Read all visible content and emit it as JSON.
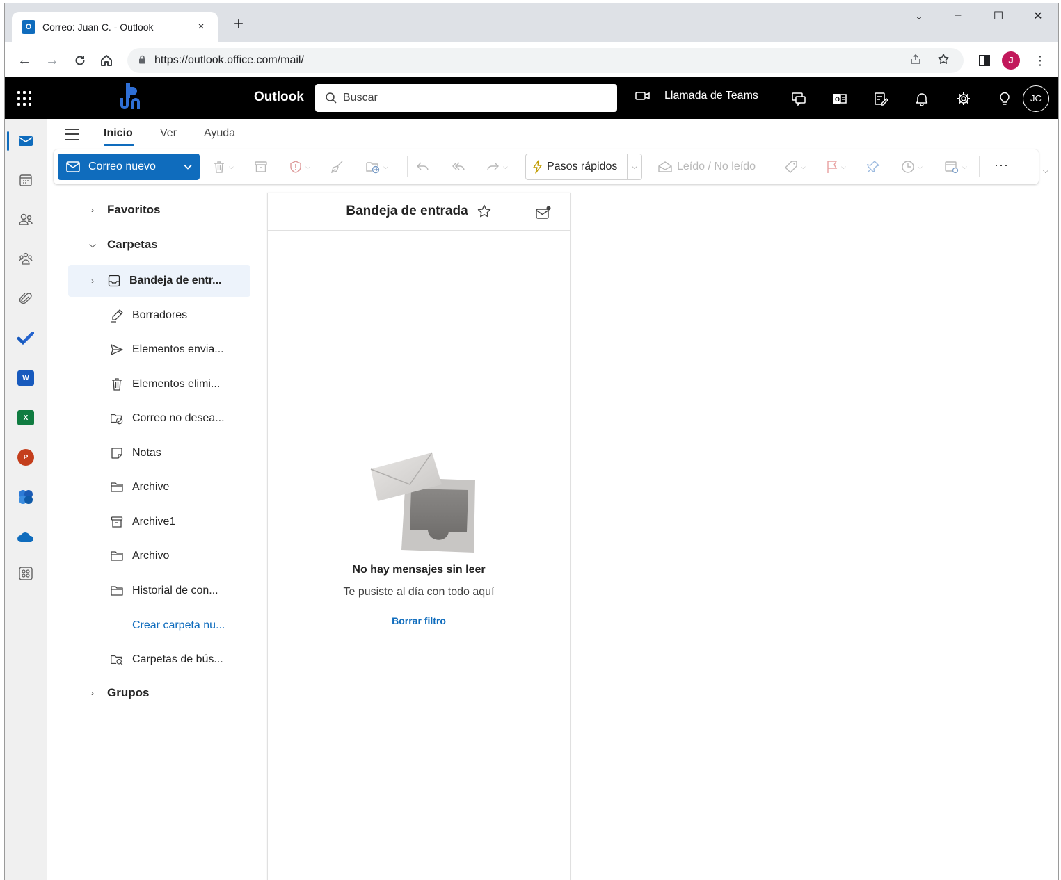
{
  "browser": {
    "tab_title": "Correo: Juan C. - Outlook",
    "tab_close": "×",
    "new_tab": "+",
    "url": "https://outlook.office.com/mail/",
    "profile_initial": "J",
    "controls": {
      "minimize": "–",
      "maximize": "☐",
      "close": "✕",
      "tab_search": "⌄"
    }
  },
  "suite": {
    "app_name": "Outlook",
    "search_placeholder": "Buscar",
    "teams_call": "Llamada de Teams",
    "user_initials": "JC"
  },
  "ribbon": {
    "tabs": [
      "Inicio",
      "Ver",
      "Ayuda"
    ],
    "active_tab": "Inicio",
    "new_mail": "Correo nuevo",
    "quick_steps": "Pasos rápidos",
    "read_unread": "Leído / No leído",
    "more": "···"
  },
  "folders": {
    "favorites": "Favoritos",
    "folders_section": "Carpetas",
    "groups": "Grupos",
    "items": [
      {
        "label": "Bandeja de entr...",
        "icon": "inbox-icon",
        "selected": true
      },
      {
        "label": "Borradores",
        "icon": "drafts-icon"
      },
      {
        "label": "Elementos envia...",
        "icon": "send-icon"
      },
      {
        "label": "Elementos elimi...",
        "icon": "trash-icon"
      },
      {
        "label": "Correo no desea...",
        "icon": "junk-icon"
      },
      {
        "label": "Notas",
        "icon": "note-icon"
      },
      {
        "label": "Archive",
        "icon": "folder-icon"
      },
      {
        "label": "Archive1",
        "icon": "archive-icon"
      },
      {
        "label": "Archivo",
        "icon": "folder-icon"
      },
      {
        "label": "Historial de con...",
        "icon": "folder-icon"
      }
    ],
    "create_folder": "Crear carpeta nu...",
    "search_folders": "Carpetas de bús..."
  },
  "message_list": {
    "title": "Bandeja de entrada",
    "empty_title": "No hay mensajes sin leer",
    "empty_subtitle": "Te pusiste al día con todo aquí",
    "clear_filter": "Borrar filtro"
  },
  "colors": {
    "accent": "#0f6cbd",
    "header_bg": "#000000",
    "rail_bg": "#f0f0f0",
    "selected_folder_bg": "#edf3fb"
  }
}
